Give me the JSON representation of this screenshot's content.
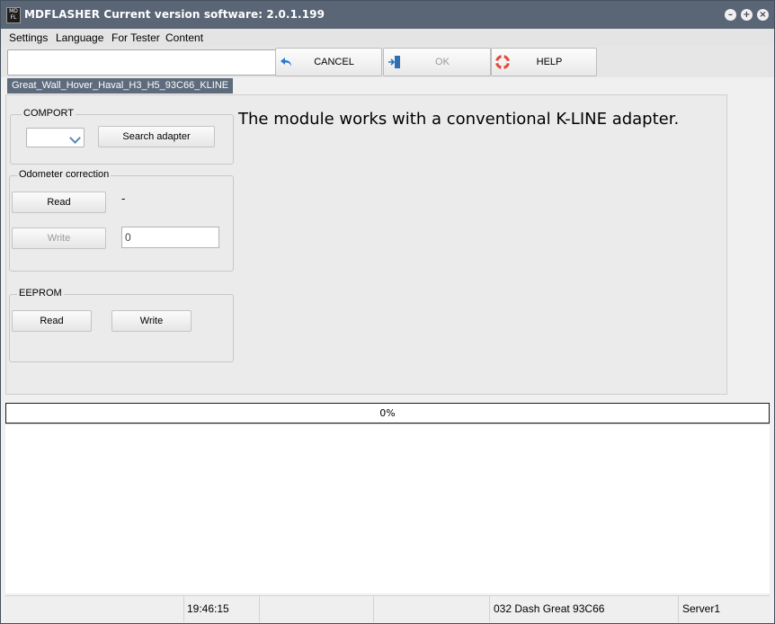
{
  "window": {
    "title": "MDFLASHER  Current version software: 2.0.1.199",
    "icon_text": "MD FL"
  },
  "menu": {
    "items": [
      "Settings",
      "Language",
      "For Tester",
      "Content"
    ]
  },
  "toolbar": {
    "input_value": "",
    "cancel_label": "CANCEL",
    "ok_label": "OK",
    "help_label": "HELP"
  },
  "tab": {
    "label": "Great_Wall_Hover_Haval_H3_H5_93C66_KLINE"
  },
  "comport": {
    "title": "COMPORT",
    "selected": "",
    "search_label": "Search adapter"
  },
  "odometer": {
    "title": "Odometer correction",
    "read_label": "Read",
    "read_value": "-",
    "write_label": "Write",
    "write_value": "0"
  },
  "eeprom": {
    "title": "EEPROM",
    "read_label": "Read",
    "write_label": "Write"
  },
  "info_text": "The module works with a conventional K-LINE adapter.",
  "progress": {
    "text": "0%",
    "value": 0
  },
  "statusbar": {
    "time": "19:46:15",
    "device": "032 Dash Great  93C66",
    "server": "Server1"
  },
  "colors": {
    "titlebar": "#5a6675",
    "tab": "#5d6b7c",
    "cancel_icon": "#2a7ad0",
    "help_icon": "#e04a3a"
  }
}
